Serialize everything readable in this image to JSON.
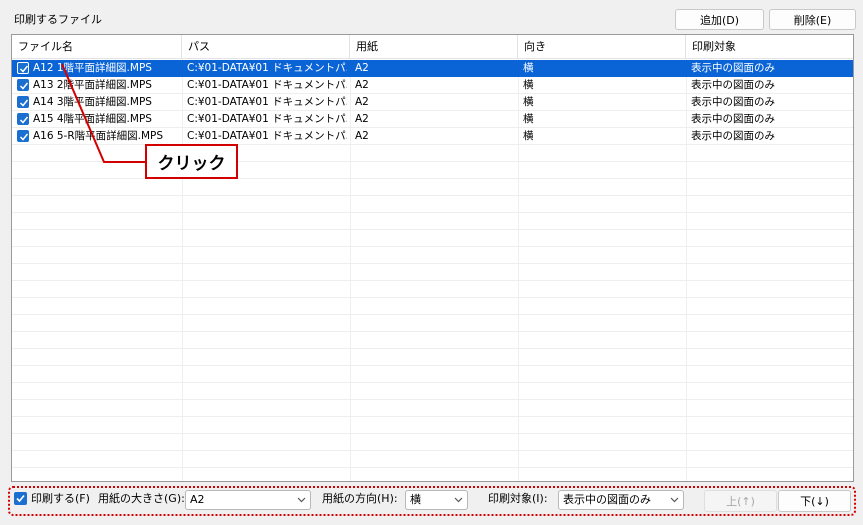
{
  "section_title": "印刷するファイル",
  "buttons": {
    "add": "追加(D)",
    "delete": "削除(E)"
  },
  "columns": [
    "ファイル名",
    "パス",
    "用紙",
    "向き",
    "印刷対象"
  ],
  "rows": [
    {
      "checked": true,
      "name": "A12 1階平面詳細図.MPS",
      "path": "C:¥01-DATA¥01 ドキュメントパ...",
      "paper": "A2",
      "orientation": "横",
      "target": "表示中の図面のみ",
      "selected": true
    },
    {
      "checked": true,
      "name": "A13 2階平面詳細図.MPS",
      "path": "C:¥01-DATA¥01 ドキュメントパ...",
      "paper": "A2",
      "orientation": "横",
      "target": "表示中の図面のみ",
      "selected": false
    },
    {
      "checked": true,
      "name": "A14 3階平面詳細図.MPS",
      "path": "C:¥01-DATA¥01 ドキュメントパ...",
      "paper": "A2",
      "orientation": "横",
      "target": "表示中の図面のみ",
      "selected": false
    },
    {
      "checked": true,
      "name": "A15 4階平面詳細図.MPS",
      "path": "C:¥01-DATA¥01 ドキュメントパ...",
      "paper": "A2",
      "orientation": "横",
      "target": "表示中の図面のみ",
      "selected": false
    },
    {
      "checked": true,
      "name": "A16 5-R階平面詳細図.MPS",
      "path": "C:¥01-DATA¥01 ドキュメントパ...",
      "paper": "A2",
      "orientation": "横",
      "target": "表示中の図面のみ",
      "selected": false
    }
  ],
  "callout": "クリック",
  "bottom": {
    "print_checked": true,
    "print_label": "印刷する(F)",
    "paper_size_label": "用紙の大きさ(G):",
    "paper_size_value": "A2",
    "orientation_label": "用紙の方向(H):",
    "orientation_value": "横",
    "target_label": "印刷対象(I):",
    "target_value": "表示中の図面のみ",
    "up_button": "上(↑)",
    "down_button": "下(↓)"
  },
  "colors": {
    "selection": "#0a64d6",
    "annotation_red": "#d40000",
    "checkbox_blue": "#1a6fd0"
  }
}
